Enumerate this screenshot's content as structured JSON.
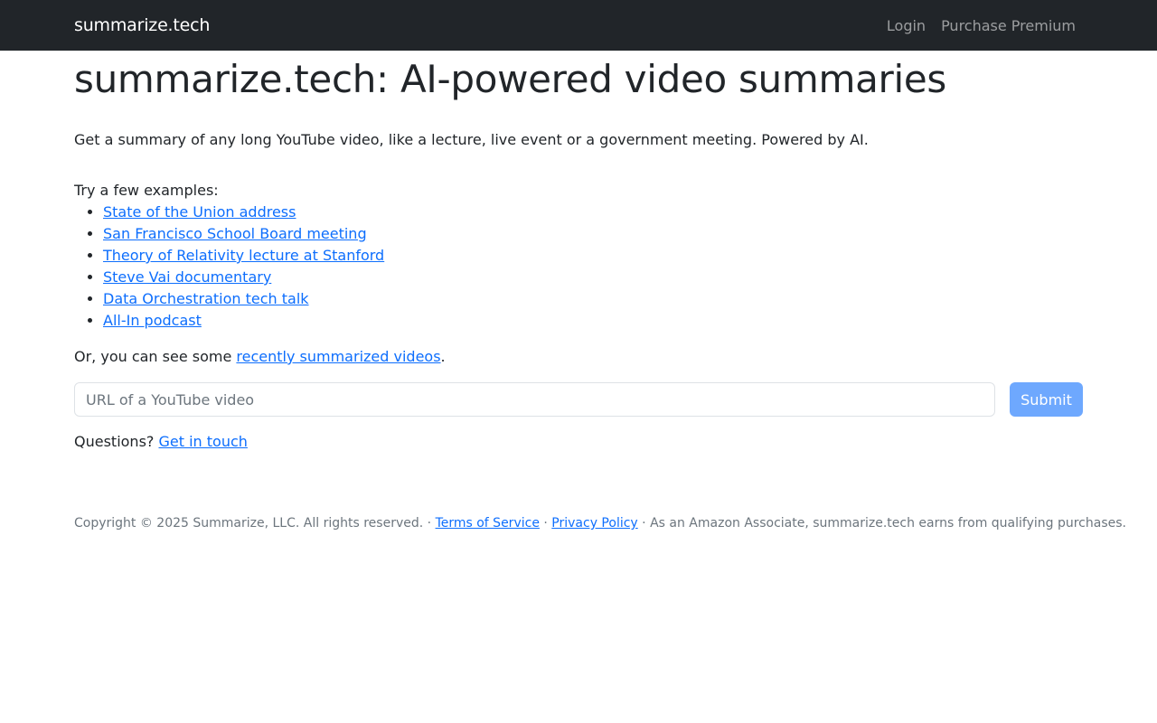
{
  "navbar": {
    "brand": "summarize.tech",
    "links": [
      "Login",
      "Purchase Premium"
    ]
  },
  "main": {
    "title": "summarize.tech: AI-powered video summaries",
    "lead": "Get a summary of any long YouTube video, like a lecture, live event or a government meeting. Powered by AI.",
    "examples_intro": "Try a few examples:",
    "examples": [
      "State of the Union address",
      "San Francisco School Board meeting",
      "Theory of Relativity lecture at Stanford",
      "Steve Vai documentary",
      "Data Orchestration tech talk",
      "All-In podcast"
    ],
    "recent_prefix": "Or, you can see some ",
    "recent_link": "recently summarized videos",
    "recent_suffix": ".",
    "url_placeholder": "URL of a YouTube video",
    "submit_label": "Submit",
    "questions_prefix": "Questions? ",
    "questions_link": "Get in touch"
  },
  "footer": {
    "copyright": "Copyright © 2025 Summarize, LLC. All rights reserved.",
    "sep": " · ",
    "terms": "Terms of Service",
    "privacy": "Privacy Policy",
    "amazon": "As an Amazon Associate, summarize.tech earns from qualifying purchases."
  },
  "colors": {
    "navbar_bg": "#212529",
    "link": "#0d6efd",
    "submit_bg": "#6ea8fe"
  }
}
